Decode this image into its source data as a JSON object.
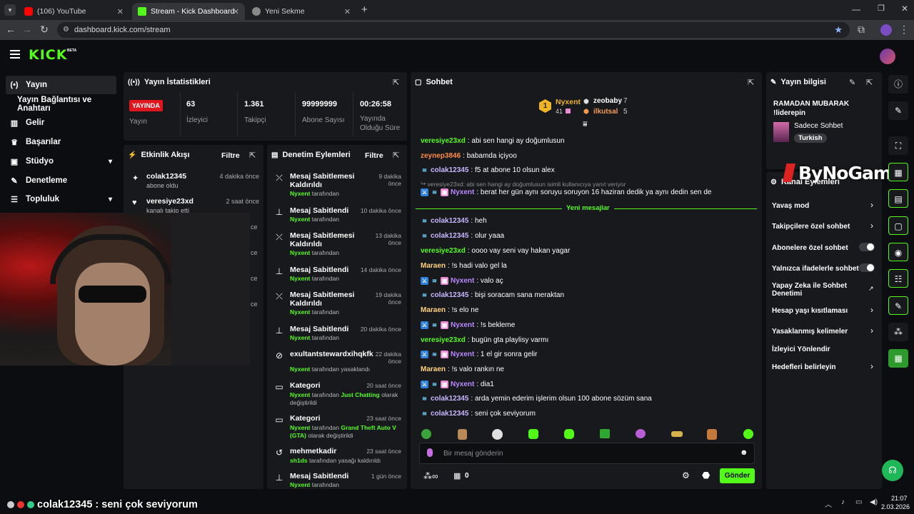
{
  "browser": {
    "tabs": [
      {
        "title": "(106) YouTube"
      },
      {
        "title": "Stream - Kick Dashboard"
      },
      {
        "title": "Yeni Sekme"
      }
    ],
    "url": "dashboard.kick.com/stream"
  },
  "header": {
    "logo": "KICK",
    "beta": "BETA"
  },
  "sidebar": {
    "items": [
      {
        "label": "Yayın"
      },
      {
        "label": "Yayın Bağlantısı ve Anahtarı"
      },
      {
        "label": "Gelir"
      },
      {
        "label": "Başarılar"
      },
      {
        "label": "Stüdyo"
      },
      {
        "label": "Denetleme"
      },
      {
        "label": "Topluluk"
      }
    ]
  },
  "stats": {
    "title": "Yayın İstatistikleri",
    "live": "YAYINDA",
    "live_label": "Yayın",
    "viewers": "63",
    "viewers_label": "İzleyici",
    "followers": "1.361",
    "followers_label": "Takipçi",
    "subs": "99999999",
    "subs_label": "Abone Sayısı",
    "uptime": "00:26:58",
    "uptime_label": "Yayında Olduğu Süre"
  },
  "activity": {
    "title": "Etkinlik Akışı",
    "filter": "Filtre",
    "items": [
      {
        "name": "colak12345",
        "sub": "abone oldu",
        "time": "4 dakika önce"
      },
      {
        "name": "veresiye23xd",
        "sub": "kanalı takip etti",
        "time": "2 saat önce"
      }
    ],
    "partial_times": [
      "ce",
      "ce",
      "ce",
      "ce"
    ]
  },
  "moderation": {
    "title": "Denetim Eylemleri",
    "filter": "Filtre",
    "by": "Nyxent",
    "by_suffix": "tarafından",
    "items": [
      {
        "title": "Mesaj Sabitlemesi Kaldırıldı",
        "time": "9 dakika önce"
      },
      {
        "title": "Mesaj Sabitlendi",
        "time": "10 dakika önce"
      },
      {
        "title": "Mesaj Sabitlemesi Kaldırıldı",
        "time": "13 dakika önce"
      },
      {
        "title": "Mesaj Sabitlendi",
        "time": "14 dakika önce"
      },
      {
        "title": "Mesaj Sabitlemesi Kaldırıldı",
        "time": "19 dakika önce"
      },
      {
        "title": "Mesaj Sabitlendi",
        "time": "20 dakika önce"
      },
      {
        "title": "exultantstewardxihqkfk",
        "time": "22 dakika önce",
        "suffix": "tarafından yasaklandı"
      },
      {
        "title": "Kategori",
        "time": "20 saat önce",
        "cat": "Just Chatting",
        "suffix2": "olarak değiştirildi"
      },
      {
        "title": "Kategori",
        "time": "23 saat önce",
        "cat": "Grand Theft Auto V (GTA)",
        "suffix2": "olarak değiştirildi"
      },
      {
        "title": "mehmetkadir",
        "time": "23 saat önce",
        "by2": "sh1ds",
        "suffix3": "tarafından yasağı kaldırıldı"
      },
      {
        "title": "Mesaj Sabitlendi",
        "time": "1 gün önce"
      }
    ]
  },
  "chat": {
    "title": "Sohbet",
    "top": [
      {
        "name": "Nyxent",
        "count": "41",
        "rank": "1"
      },
      {
        "name": "zeobaby",
        "count": "7"
      },
      {
        "name": "ilkutsal",
        "count": "5"
      }
    ],
    "messages": [
      {
        "user": "veresiye23xd",
        "text": "abi sen hangi ay doğumlusun",
        "cls": "u1"
      },
      {
        "user": "zeynep3846",
        "text": "babamda içiyoo",
        "cls": "u2"
      },
      {
        "user": "colak12345",
        "text": "f5 at abone 10 olsun alex",
        "cls": "u3"
      }
    ],
    "reply_ref": "veresiye23xd: abi sen hangi ay doğumlusun isimli kullanıcıya yanıt veriyor",
    "reply_user": "Nyxent",
    "reply_text": "berat her gün aynı soruyu soruyon 16 haziran dedik ya aynı dedin sen de",
    "new_label": "Yeni mesajlar",
    "new_messages": [
      {
        "user": "colak12345",
        "text": "heh",
        "cls": "u3"
      },
      {
        "user": "colak12345",
        "text": "olur yaaa",
        "cls": "u3"
      },
      {
        "user": "veresiye23xd",
        "text": "oooo vay seni vay hakan yagar",
        "cls": "u1"
      },
      {
        "user": "Maraen",
        "text": "!s hadi valo gel la",
        "cls": "u4"
      },
      {
        "user": "Nyxent",
        "text": "valo aç",
        "cls": "u5"
      },
      {
        "user": "colak12345",
        "text": "bişi soracam sana meraktan",
        "cls": "u3"
      },
      {
        "user": "Maraen",
        "text": "!s elo ne",
        "cls": "u4"
      },
      {
        "user": "Nyxent",
        "text": "!s bekleme",
        "cls": "u5"
      },
      {
        "user": "veresiye23xd",
        "text": "bugün gta playlisy varmı",
        "cls": "u1"
      },
      {
        "user": "Nyxent",
        "text": "1 el gir sonra gelir",
        "cls": "u5"
      },
      {
        "user": "Maraen",
        "text": "!s valo rankın ne",
        "cls": "u4"
      },
      {
        "user": "Nyxent",
        "text": "dia1",
        "cls": "u5"
      },
      {
        "user": "colak12345",
        "text": "arda yemin ederim işlerim olsun 100 abone sözüm sana",
        "cls": "u3"
      },
      {
        "user": "colak12345",
        "text": "seni çok seviyorum",
        "cls": "u3"
      }
    ],
    "placeholder": "Bir mesaj gönderin",
    "points": "0",
    "send": "Gönder"
  },
  "info": {
    "title": "Yayın bilgisi",
    "stream_title": "RAMADAN MUBARAK !liderepin",
    "category": "Sadece Sohbet",
    "tag": "Turkish"
  },
  "channel": {
    "title": "Kanal Eylemleri",
    "items": [
      {
        "label": "Yavaş mod"
      },
      {
        "label": "Takipçilere özel sohbet"
      },
      {
        "label": "Abonelere özel sohbet"
      },
      {
        "label": "Yalnızca ifadelerle sohbet"
      },
      {
        "label": "Yapay Zeka ile Sohbet Denetimi"
      },
      {
        "label": "Hesap yaşı kısıtlaması"
      },
      {
        "label": "Yasaklanmış kelimeler"
      },
      {
        "label": "İzleyici Yönlendir"
      },
      {
        "label": "Hedefleri belirleyin"
      }
    ]
  },
  "overlay": {
    "watermark": "ByNoGame",
    "caption": "colak12345 : seni çok seviyorum"
  },
  "taskbar": {
    "time": "21:07",
    "date": "2.03.2026"
  },
  "colors": {
    "brand": "#53fc18",
    "live": "#e0151e",
    "panel": "#18191c"
  }
}
